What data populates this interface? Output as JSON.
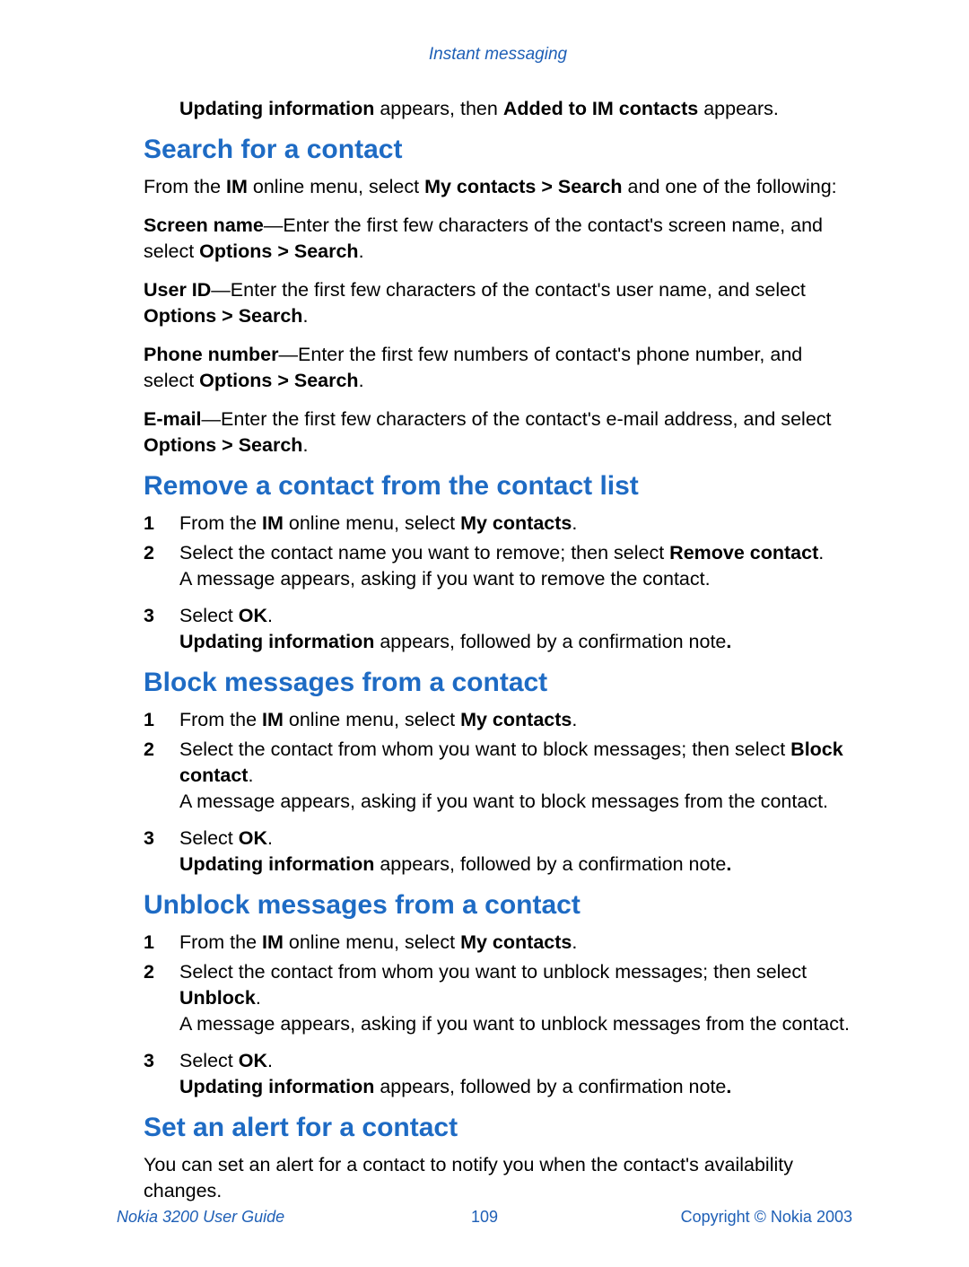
{
  "header": "Instant messaging",
  "intro": {
    "b1": "Updating information",
    "t1": " appears, then ",
    "b2": "Added to IM contacts",
    "t2": " appears."
  },
  "search": {
    "heading": "Search for a contact",
    "p1": {
      "t1": "From the ",
      "b1": "IM",
      "t2": " online menu, select ",
      "b2": "My contacts > Search",
      "t3": " and one of the following:"
    },
    "p2": {
      "b1": "Screen name",
      "t1": "—Enter the first few characters of the contact's screen name, and select ",
      "b2": "Options > Search",
      "t2": "."
    },
    "p3": {
      "b1": "User ID",
      "t1": "—Enter the first few characters of the contact's user name, and select ",
      "b2": "Options > Search",
      "t2": "."
    },
    "p4": {
      "b1": "Phone number",
      "t1": "—Enter the first few numbers of contact's phone number, and select ",
      "b2": "Options > Search",
      "t2": "."
    },
    "p5": {
      "b1": "E-mail",
      "t1": "—Enter the first few characters of the contact's e-mail address, and select ",
      "b2": "Options > Search",
      "t2": "."
    }
  },
  "remove": {
    "heading": "Remove a contact from the contact list",
    "s1": {
      "n": "1",
      "t1": "From the ",
      "b1": "IM",
      "t2": " online menu, select ",
      "b2": "My contacts",
      "t3": "."
    },
    "s2": {
      "n": "2",
      "t1": "Select the contact name you want to remove; then select ",
      "b1": "Remove contact",
      "t2": ".",
      "line2": "A message appears, asking if you want to remove the contact."
    },
    "s3": {
      "n": "3",
      "t1": "Select ",
      "b1": "OK",
      "t2": ".",
      "line2b": "Updating information",
      "line2t": " appears, followed by a confirmation note",
      "line2b2": "."
    }
  },
  "block": {
    "heading": "Block messages from a contact",
    "s1": {
      "n": "1",
      "t1": "From the ",
      "b1": "IM",
      "t2": " online menu, select ",
      "b2": "My contacts",
      "t3": "."
    },
    "s2": {
      "n": "2",
      "t1": "Select the contact from whom you want to block messages; then select ",
      "b1": "Block contact",
      "t2": ".",
      "line2": "A message appears, asking if you want to block messages from the contact."
    },
    "s3": {
      "n": "3",
      "t1": "Select ",
      "b1": "OK",
      "t2": ".",
      "line2b": "Updating information",
      "line2t": " appears, followed by a confirmation note",
      "line2b2": "."
    }
  },
  "unblock": {
    "heading": "Unblock messages from a contact",
    "s1": {
      "n": "1",
      "t1": "From the ",
      "b1": "IM",
      "t2": " online menu, select ",
      "b2": "My contacts",
      "t3": "."
    },
    "s2": {
      "n": "2",
      "t1": "Select the contact from whom you want to unblock messages; then select ",
      "b1": "Unblock",
      "t2": ".",
      "line2": "A message appears, asking if you want to unblock messages from the contact."
    },
    "s3": {
      "n": "3",
      "t1": "Select ",
      "b1": "OK",
      "t2": ".",
      "line2b": "Updating information",
      "line2t": " appears, followed by a confirmation note",
      "line2b2": "."
    }
  },
  "alert": {
    "heading": "Set an alert for a contact",
    "p1": "You can set an alert for a contact to notify you when the contact's availability changes."
  },
  "footer": {
    "left": "Nokia 3200 User Guide",
    "center": "109",
    "right": "Copyright © Nokia 2003"
  }
}
